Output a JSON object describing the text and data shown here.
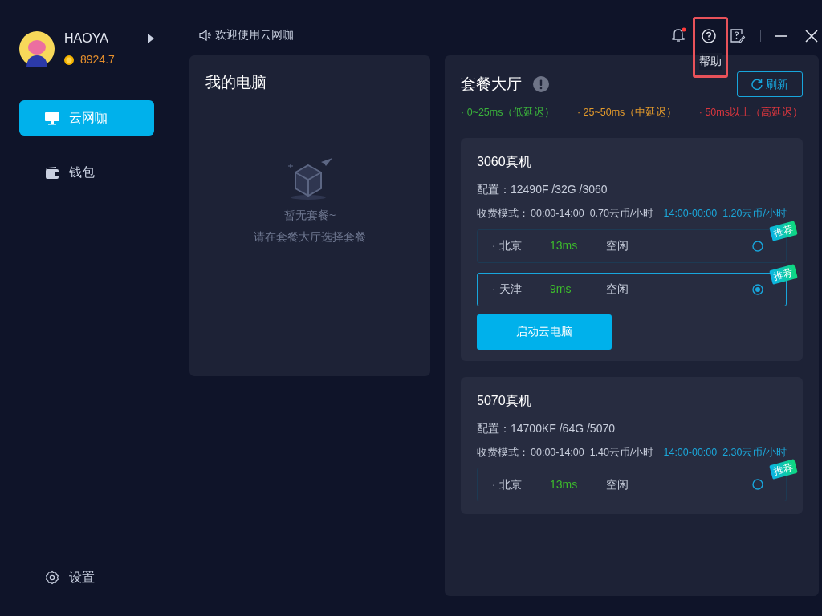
{
  "sidebar": {
    "user": {
      "name": "HAOYA",
      "coins": "8924.7"
    },
    "items": [
      {
        "label": "云网咖",
        "selected": true
      },
      {
        "label": "钱包",
        "selected": false
      }
    ],
    "settings": {
      "label": "设置"
    }
  },
  "topbar": {
    "notice": "欢迎使用云网咖",
    "tools": [
      {
        "kind": "bell",
        "unread": true,
        "highlighted": false
      },
      {
        "kind": "help",
        "unread": false,
        "highlighted": true,
        "tooltip": "帮助"
      },
      {
        "kind": "feedback",
        "unread": false,
        "highlighted": false
      }
    ]
  },
  "my_pc": {
    "title": "我的电脑",
    "empty_title": "暂无套餐~",
    "empty_hint": "请在套餐大厅选择套餐"
  },
  "hall": {
    "title": "套餐大厅",
    "refresh": "刷新",
    "legend": [
      {
        "label": "· 0~25ms（低延迟）",
        "color": "#3bb33b"
      },
      {
        "label": "· 25~50ms（中延迟）",
        "color": "#e39a2c"
      },
      {
        "label": "· 50ms以上（高延迟）",
        "color": "#d9363e"
      }
    ],
    "packages": [
      {
        "title": "3060真机",
        "config": "配置：12490F /32G /3060",
        "billing_label": "收费模式：",
        "periods": [
          {
            "time": "00:00-14:00",
            "price": "0.70云币/小时",
            "kind": "normal"
          },
          {
            "time": "14:00-00:00",
            "price": "1.20云币/小时",
            "kind": "peak"
          }
        ],
        "servers": [
          {
            "city": "· 北京",
            "latency": "13ms",
            "status": "空闲",
            "badge": "推荐",
            "selected": false
          },
          {
            "city": "· 天津",
            "latency": "9ms",
            "status": "空闲",
            "badge": "推荐",
            "selected": true
          }
        ],
        "start_button": "启动云电脑"
      },
      {
        "title": "5070真机",
        "config": "配置：14700KF /64G /5070",
        "billing_label": "收费模式：",
        "periods": [
          {
            "time": "00:00-14:00",
            "price": "1.40云币/小时",
            "kind": "normal"
          },
          {
            "time": "14:00-00:00",
            "price": "2.30云币/小时",
            "kind": "peak"
          }
        ],
        "servers": [
          {
            "city": "· 北京",
            "latency": "13ms",
            "status": "空闲",
            "badge": "推荐",
            "selected": false
          }
        ]
      }
    ]
  }
}
